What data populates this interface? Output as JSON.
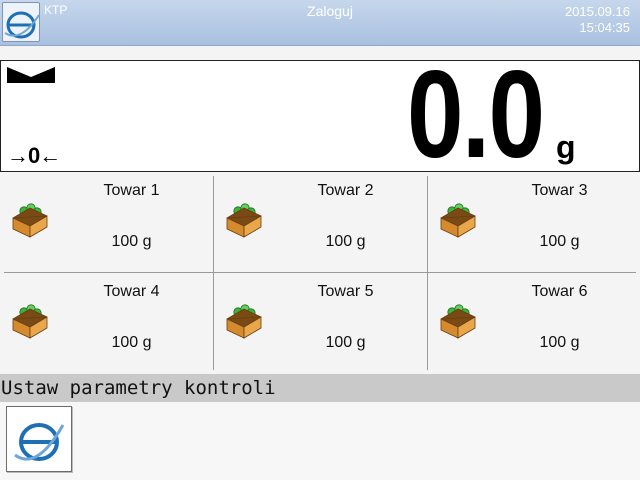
{
  "header": {
    "mode": "KTP",
    "login": "Zaloguj",
    "date": "2015.09.16",
    "time": "15:04:35",
    "logo_icon": "e-logo-icon"
  },
  "display": {
    "weight": "0.0",
    "unit": "g",
    "zero_indicator": "→0←",
    "stable_icon": "stability-icon"
  },
  "products": [
    {
      "name": "Towar 1",
      "weight": "100 g",
      "icon": "product-box-icon"
    },
    {
      "name": "Towar 2",
      "weight": "100 g",
      "icon": "product-box-icon"
    },
    {
      "name": "Towar 3",
      "weight": "100 g",
      "icon": "product-box-icon"
    },
    {
      "name": "Towar 4",
      "weight": "100 g",
      "icon": "product-box-icon"
    },
    {
      "name": "Towar 5",
      "weight": "100 g",
      "icon": "product-box-icon"
    },
    {
      "name": "Towar 6",
      "weight": "100 g",
      "icon": "product-box-icon"
    }
  ],
  "message": "Ustaw parametry kontroli",
  "colors": {
    "header_bg": "#b3c8e6",
    "header_text": "#ffffff",
    "logo_blue": "#1d6fb6",
    "message_bar": "#c9c9c9"
  }
}
